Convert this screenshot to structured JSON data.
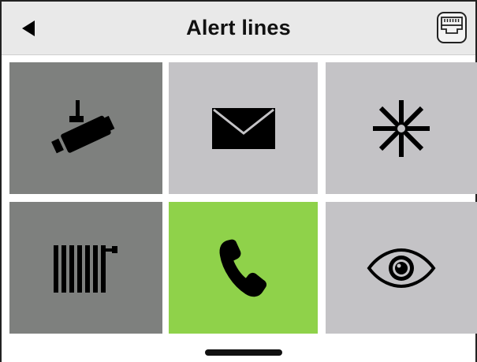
{
  "header": {
    "title": "Alert lines",
    "back_icon": "back-arrow-icon",
    "network_icon": "network-port-icon"
  },
  "tiles": [
    {
      "icon": "security-camera-icon",
      "color": "#7e807e",
      "selected": false
    },
    {
      "icon": "envelope-icon",
      "color": "#c4c3c6",
      "selected": false
    },
    {
      "icon": "asterisk-icon",
      "color": "#c4c3c6",
      "selected": false
    },
    {
      "icon": "radiator-icon",
      "color": "#7e807e",
      "selected": false
    },
    {
      "icon": "phone-icon",
      "color": "#8fd24a",
      "selected": true
    },
    {
      "icon": "eye-icon",
      "color": "#c4c3c6",
      "selected": false
    }
  ],
  "colors": {
    "header_bg": "#e9e9e9",
    "icon": "#000000"
  }
}
